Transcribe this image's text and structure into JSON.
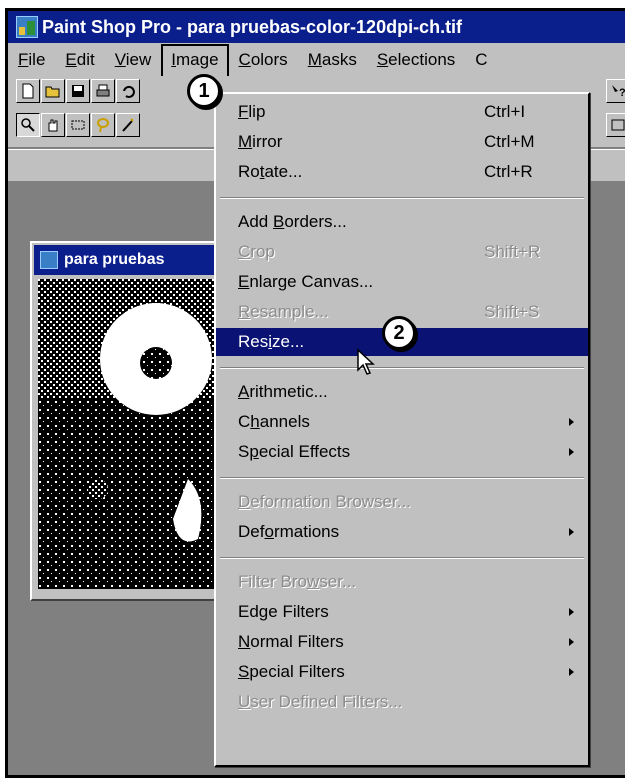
{
  "window": {
    "title": "Paint Shop Pro - para pruebas-color-120dpi-ch.tif"
  },
  "menubar": [
    {
      "label": "File",
      "ul": "F",
      "rest": "ile"
    },
    {
      "label": "Edit",
      "ul": "E",
      "rest": "dit"
    },
    {
      "label": "View",
      "ul": "V",
      "rest": "iew"
    },
    {
      "label": "Image",
      "ul": "I",
      "rest": "mage"
    },
    {
      "label": "Colors",
      "ul": "C",
      "rest": "olors"
    },
    {
      "label": "Masks",
      "ul": "M",
      "rest": "asks"
    },
    {
      "label": "Selections",
      "ul": "S",
      "rest": "elections"
    },
    {
      "label": "C",
      "ul": "",
      "rest": "C"
    }
  ],
  "document": {
    "title": "para pruebas"
  },
  "image_menu": {
    "items": [
      {
        "pre": "",
        "ul": "F",
        "post": "lip",
        "shortcut": "Ctrl+I",
        "state": "normal",
        "submenu": false
      },
      {
        "pre": "",
        "ul": "M",
        "post": "irror",
        "shortcut": "Ctrl+M",
        "state": "normal",
        "submenu": false
      },
      {
        "pre": "Ro",
        "ul": "t",
        "post": "ate...",
        "shortcut": "Ctrl+R",
        "state": "normal",
        "submenu": false
      },
      {
        "sep": true
      },
      {
        "pre": "Add ",
        "ul": "B",
        "post": "orders...",
        "shortcut": "",
        "state": "normal",
        "submenu": false
      },
      {
        "pre": "",
        "ul": "C",
        "post": "rop",
        "shortcut": "Shift+R",
        "state": "disabled",
        "submenu": false
      },
      {
        "pre": "",
        "ul": "E",
        "post": "nlarge Canvas...",
        "shortcut": "",
        "state": "normal",
        "submenu": false
      },
      {
        "pre": "",
        "ul": "R",
        "post": "esample...",
        "shortcut": "Shift+S",
        "state": "disabled",
        "submenu": false
      },
      {
        "pre": "Res",
        "ul": "i",
        "post": "ze...",
        "shortcut": "",
        "state": "highlight",
        "submenu": false
      },
      {
        "sep": true
      },
      {
        "pre": "",
        "ul": "A",
        "post": "rithmetic...",
        "shortcut": "",
        "state": "normal",
        "submenu": false
      },
      {
        "pre": "C",
        "ul": "h",
        "post": "annels",
        "shortcut": "",
        "state": "normal",
        "submenu": true
      },
      {
        "pre": "S",
        "ul": "p",
        "post": "ecial Effects",
        "shortcut": "",
        "state": "normal",
        "submenu": true
      },
      {
        "sep": true
      },
      {
        "pre": "",
        "ul": "D",
        "post": "eformation Browser...",
        "shortcut": "",
        "state": "disabled",
        "submenu": false
      },
      {
        "pre": "Def",
        "ul": "o",
        "post": "rmations",
        "shortcut": "",
        "state": "normal",
        "submenu": true
      },
      {
        "sep": true
      },
      {
        "pre": "Filter Bro",
        "ul": "w",
        "post": "ser...",
        "shortcut": "",
        "state": "disabled",
        "submenu": false
      },
      {
        "pre": "Ed",
        "ul": "g",
        "post": "e Filters",
        "shortcut": "",
        "state": "normal",
        "submenu": true
      },
      {
        "pre": "",
        "ul": "N",
        "post": "ormal Filters",
        "shortcut": "",
        "state": "normal",
        "submenu": true
      },
      {
        "pre": "",
        "ul": "S",
        "post": "pecial Filters",
        "shortcut": "",
        "state": "normal",
        "submenu": true
      },
      {
        "pre": "",
        "ul": "U",
        "post": "ser Defined Filters...",
        "shortcut": "",
        "state": "disabled",
        "submenu": false
      }
    ]
  },
  "callouts": [
    "1",
    "2"
  ]
}
